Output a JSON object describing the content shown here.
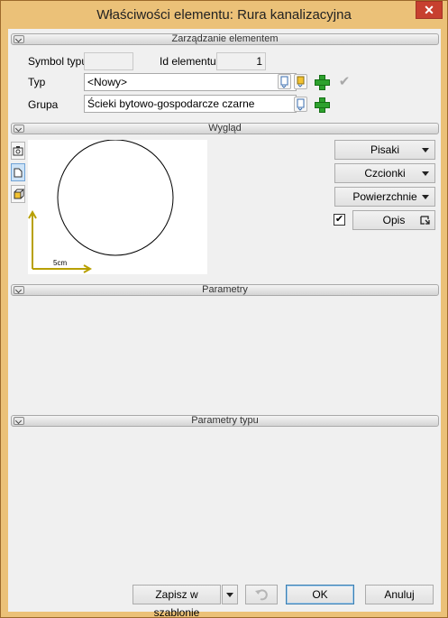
{
  "window": {
    "title": "Właściwości elementu: Rura kanalizacyjna",
    "close_label": "✕"
  },
  "sections": {
    "management": "Zarządzanie elementem",
    "appearance": "Wygląd",
    "parameters": "Parametry",
    "type_parameters": "Parametry typu"
  },
  "management": {
    "symbol_label": "Symbol typu",
    "symbol_value": "",
    "id_label": "Id elementu",
    "id_value": "1",
    "type_label": "Typ",
    "type_value": "<Nowy>",
    "group_label": "Grupa",
    "group_value": "Ścieki bytowo-gospodarcze czarne"
  },
  "appearance": {
    "scale_label": "5cm",
    "buttons": {
      "pens": "Pisaki",
      "fonts": "Czcionki",
      "surfaces": "Powierzchnie",
      "description": "Opis"
    },
    "description_checked": true,
    "tools": [
      "camera-icon",
      "plan-view-icon",
      "3d-view-icon"
    ]
  },
  "footer": {
    "save_template": "Zapisz w szablonie",
    "ok": "OK",
    "cancel": "Anuluj"
  },
  "colors": {
    "frame": "#ebc178",
    "accent": "#2da12d",
    "close": "#c7402f"
  }
}
